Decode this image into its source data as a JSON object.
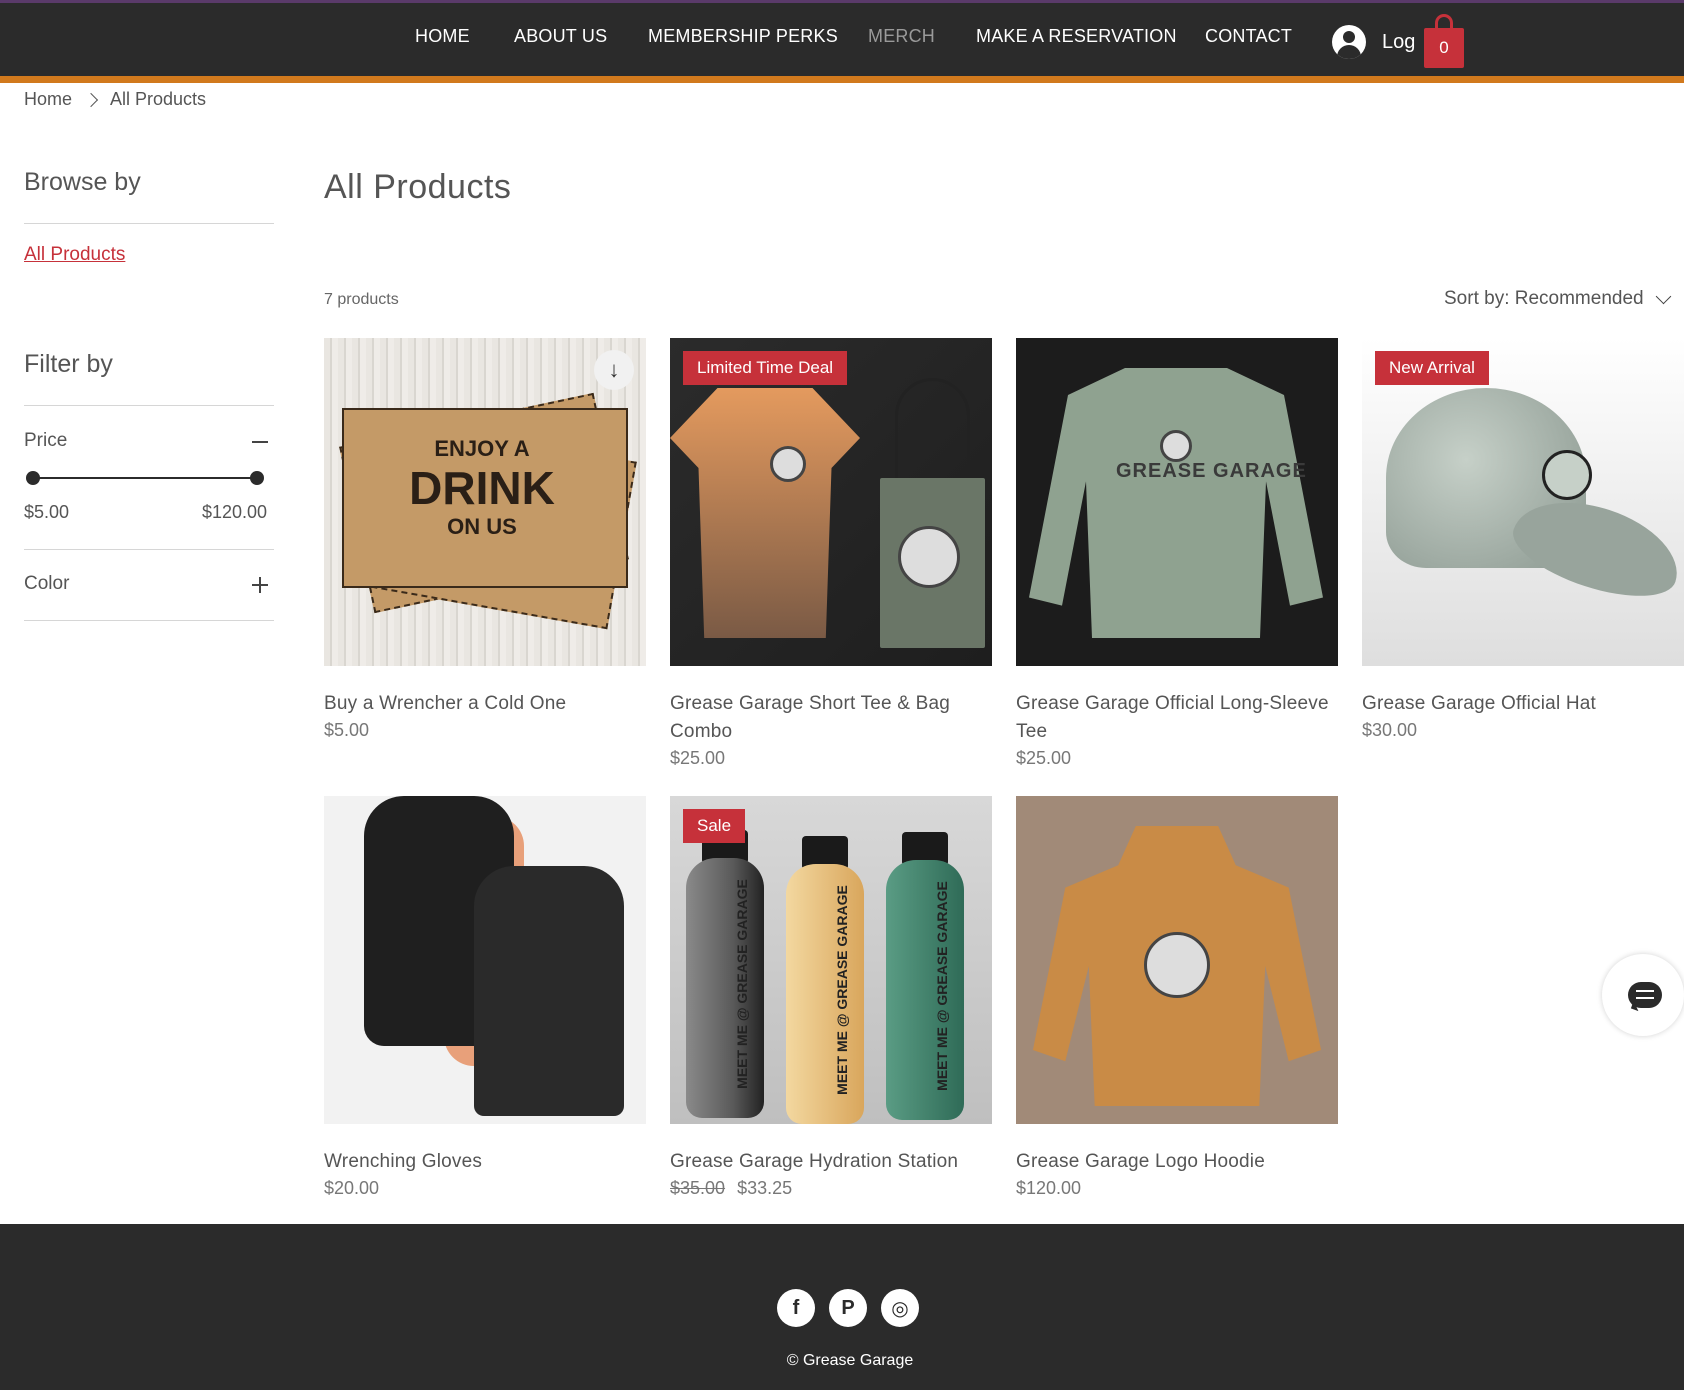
{
  "header": {
    "nav": [
      {
        "label": "HOME",
        "active": false
      },
      {
        "label": "ABOUT US",
        "active": false
      },
      {
        "label": "MEMBERSHIP PERKS",
        "active": false
      },
      {
        "label": "MERCH",
        "active": true
      },
      {
        "label": "MAKE A RESERVATION",
        "active": false
      },
      {
        "label": "CONTACT",
        "active": false
      }
    ],
    "login_label": "Log In",
    "cart_count": "0",
    "accent_color": "#d1791d",
    "cart_color": "#c6313a"
  },
  "breadcrumb": {
    "items": [
      "Home",
      "All Products"
    ]
  },
  "sidebar": {
    "browse_title": "Browse by",
    "browse_link": "All Products",
    "filter_title": "Filter by",
    "price_label": "Price",
    "price_min": "$5.00",
    "price_max": "$120.00",
    "color_label": "Color"
  },
  "main": {
    "title": "All Products",
    "count": "7 products",
    "sort_label": "Sort by: Recommended",
    "products": [
      {
        "name": "Buy a Wrencher a Cold One",
        "price": "$5.00",
        "old_price": "",
        "ribbon": ""
      },
      {
        "name": "Grease Garage Short Tee & Bag Combo",
        "price": "$25.00",
        "old_price": "",
        "ribbon": "Limited Time Deal"
      },
      {
        "name": "Grease Garage Official Long-Sleeve Tee",
        "price": "$25.00",
        "old_price": "",
        "ribbon": ""
      },
      {
        "name": "Grease Garage Official Hat",
        "price": "$30.00",
        "old_price": "",
        "ribbon": "New Arrival"
      },
      {
        "name": "Wrenching Gloves",
        "price": "$20.00",
        "old_price": "",
        "ribbon": ""
      },
      {
        "name": "Grease Garage Hydration Station",
        "price": "$33.25",
        "old_price": "$35.00",
        "ribbon": "Sale"
      },
      {
        "name": "Grease Garage Logo Hoodie",
        "price": "$120.00",
        "old_price": "",
        "ribbon": ""
      }
    ],
    "thumb_text": {
      "drink_a": "ENJOY A",
      "drink_b": "DRINK",
      "drink_c": "ON US",
      "long_sleeve": "GREASE GARAGE",
      "bottle": "MEET ME @ GREASE GARAGE"
    }
  },
  "footer": {
    "social": [
      {
        "icon": "facebook-icon",
        "glyph": "f"
      },
      {
        "icon": "pinterest-icon",
        "glyph": "P"
      },
      {
        "icon": "instagram-icon",
        "glyph": "◎"
      }
    ],
    "copyright": "© Grease Garage"
  }
}
